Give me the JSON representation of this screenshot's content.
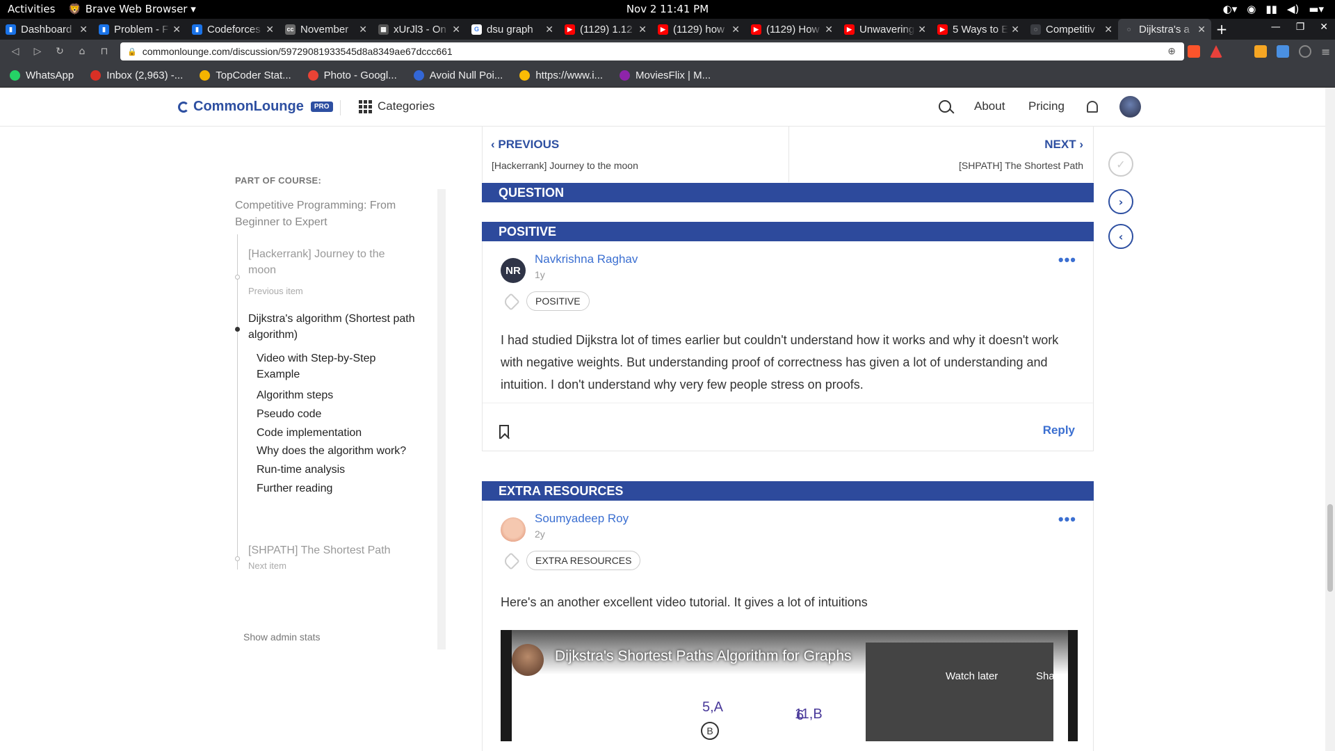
{
  "system": {
    "activities": "Activities",
    "app_name": "Brave Web Browser ▾",
    "clock": "Nov 2  11:41 PM"
  },
  "tabs": [
    {
      "label": "Dashboard",
      "color": "#1a73e8",
      "glyph": "▮"
    },
    {
      "label": "Problem - F",
      "color": "#1a73e8",
      "glyph": "▮"
    },
    {
      "label": "Codeforces",
      "color": "#1a73e8",
      "glyph": "▮"
    },
    {
      "label": "November",
      "color": "#6b6b6b",
      "glyph": "cc"
    },
    {
      "label": "xUrJl3 - On",
      "color": "#555555",
      "glyph": "▦"
    },
    {
      "label": "dsu graph",
      "color": "#ffffff",
      "glyph": "G"
    },
    {
      "label": "(1129) 1.12",
      "color": "#ff0000",
      "glyph": "▶"
    },
    {
      "label": "(1129) how",
      "color": "#ff0000",
      "glyph": "▶"
    },
    {
      "label": "(1129) How",
      "color": "#ff0000",
      "glyph": "▶"
    },
    {
      "label": "Unwavering",
      "color": "#ff0000",
      "glyph": "▶"
    },
    {
      "label": "5 Ways to E",
      "color": "#ff0000",
      "glyph": "▶"
    },
    {
      "label": "Competitiv",
      "color": "#3a3c41",
      "glyph": "◌"
    },
    {
      "label": "Dijkstra's a",
      "color": "#3a3c41",
      "glyph": "◌"
    }
  ],
  "address": {
    "url": "commonlounge.com/discussion/59729081933545d8a8349ae67dccc661"
  },
  "bookmarks": [
    {
      "label": "WhatsApp",
      "color": "#25d366"
    },
    {
      "label": "Inbox (2,963) -...",
      "color": "#d93025"
    },
    {
      "label": "TopCoder Stat...",
      "color": "#f4b400"
    },
    {
      "label": "Photo - Googl...",
      "color": "#ea4335"
    },
    {
      "label": "Avoid Null Poi...",
      "color": "#3367d6"
    },
    {
      "label": "https://www.i...",
      "color": "#fbbc05"
    },
    {
      "label": "MoviesFlix | M...",
      "color": "#8e24aa"
    }
  ],
  "header": {
    "logo": "CommonLounge",
    "pro": "PRO",
    "categories": "Categories",
    "about": "About",
    "pricing": "Pricing"
  },
  "sidebar": {
    "caption": "PART OF COURSE:",
    "course": "Competitive Programming: From Beginner to Expert",
    "prev_item": "[Hackerrank] Journey to the moon",
    "prev_meta": "Previous item",
    "current": "Dijkstra's algorithm (Shortest path algorithm)",
    "sections": [
      "Video with Step-by-Step Example",
      "Algorithm steps",
      "Pseudo code",
      "Code implementation",
      "Why does the algorithm work?",
      "Run-time analysis",
      "Further reading"
    ],
    "next_item": "[SHPATH] The Shortest Path",
    "next_meta": "Next item",
    "admin": "Show admin stats"
  },
  "prevnext": {
    "prev_label": "PREVIOUS",
    "prev_title": "[Hackerrank] Journey to the moon",
    "next_label": "NEXT",
    "next_title": "[SHPATH] The Shortest Path"
  },
  "bands": {
    "question": "QUESTION",
    "positive": "POSITIVE",
    "extra": "EXTRA RESOURCES"
  },
  "comment1": {
    "initials": "NR",
    "author": "Navkrishna Raghav",
    "time": "1y",
    "tag": "POSITIVE",
    "body": "I had studied Dijkstra lot of times earlier but couldn't understand how it works and why it doesn't work with negative weights. But understanding proof of correctness has given a lot of understanding and intuition. I don't understand why very few people stress on proofs.",
    "reply": "Reply"
  },
  "comment2": {
    "author": "Soumyadeep Roy",
    "time": "2y",
    "tag": "EXTRA RESOURCES",
    "body": "Here's an another excellent video tutorial. It gives a lot of intuitions"
  },
  "video": {
    "title": "Dijkstra's Shortest Paths Algorithm for Graphs",
    "watch_later": "Watch later",
    "share": "Share",
    "label_a": "5,A",
    "label_b": "11,B",
    "edge": "6",
    "node_b": "B"
  },
  "colors": {
    "brand": "#2d4fa1",
    "link": "#3b6fd1"
  }
}
